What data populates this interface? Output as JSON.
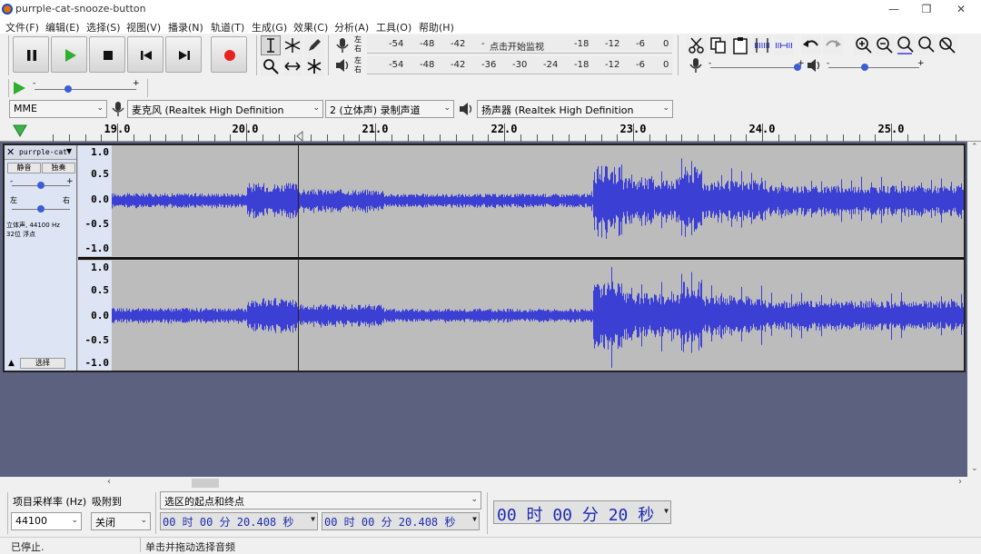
{
  "window": {
    "title": "purrple-cat-snooze-button",
    "minimize": "—",
    "restore": "❐",
    "close": "✕"
  },
  "menu": [
    "文件(F)",
    "编辑(E)",
    "选择(S)",
    "视图(V)",
    "播录(N)",
    "轨道(T)",
    "生成(G)",
    "效果(C)",
    "分析(A)",
    "工具(O)",
    "帮助(H)"
  ],
  "meters": {
    "record_ticks": [
      "-54",
      "-48",
      "-42",
      "-",
      "-18",
      "-12",
      "-6",
      "0"
    ],
    "record_prompt": "点击开始监视",
    "playback_ticks": [
      "-54",
      "-48",
      "-42",
      "-36",
      "-30",
      "-24",
      "-18",
      "-12",
      "-6",
      "0"
    ],
    "lr_left": "左",
    "lr_right": "右"
  },
  "devices": {
    "host": "MME",
    "input": "麦克风 (Realtek High Definition",
    "channels": "2 (立体声) 录制声道",
    "output": "扬声器 (Realtek High Definition"
  },
  "ruler": {
    "labels": [
      "19.0",
      "20.0",
      "21.0",
      "22.0",
      "23.0",
      "24.0",
      "25.0"
    ]
  },
  "track": {
    "name": "purrple-cat-",
    "mute": "静音",
    "solo": "独奏",
    "pan_left": "左",
    "pan_right": "右",
    "info_line1": "立体声, 44100 Hz",
    "info_line2": "32位 浮点",
    "select": "选择",
    "scale": [
      "1.0",
      "0.5",
      "0.0",
      "-0.5",
      "-1.0"
    ]
  },
  "selection_toolbar": {
    "rate_label": "项目采样率 (Hz)",
    "snap_label": "吸附到",
    "rate_value": "44100",
    "snap_value": "关闭",
    "mode": "选区的起点和终点",
    "start": "00 时 00 分 20.408 秒",
    "end": "00 时 00 分 20.408 秒",
    "position": "00 时 00 分 20 秒"
  },
  "status": {
    "left": "已停止.",
    "right": "单击并拖动选择音频"
  },
  "colors": {
    "wave": "#3b3fd3",
    "track_bg": "#5c6180",
    "record": "#e82222",
    "play": "#2fae2f"
  }
}
